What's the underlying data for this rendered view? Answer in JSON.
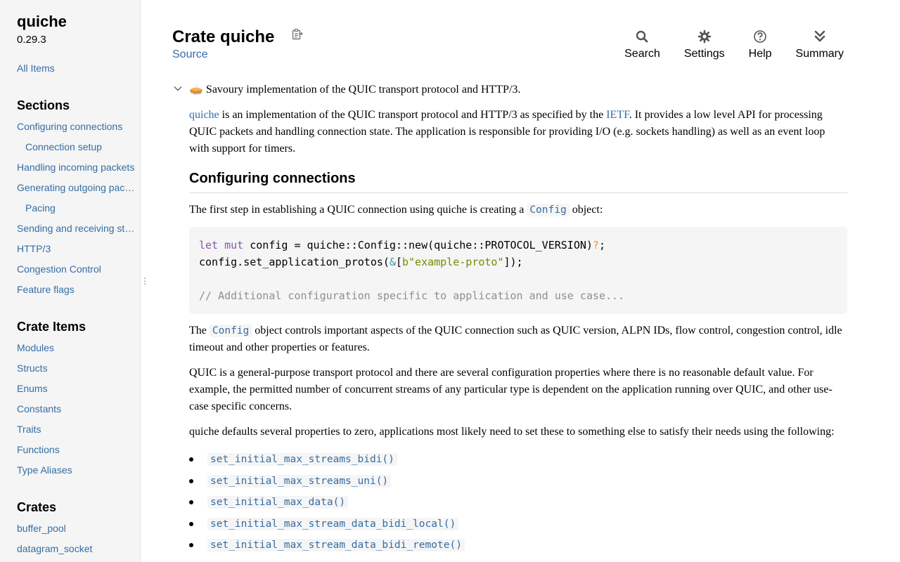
{
  "sidebar": {
    "crate_name": "quiche",
    "version": "0.29.3",
    "all_items": "All Items",
    "sections_heading": "Sections",
    "sections": [
      {
        "label": "Configuring connections",
        "sub": false
      },
      {
        "label": "Connection setup",
        "sub": true
      },
      {
        "label": "Handling incoming packets",
        "sub": false
      },
      {
        "label": "Generating outgoing packets",
        "sub": false
      },
      {
        "label": "Pacing",
        "sub": true
      },
      {
        "label": "Sending and receiving stream data",
        "sub": false
      },
      {
        "label": "HTTP/3",
        "sub": false
      },
      {
        "label": "Congestion Control",
        "sub": false
      },
      {
        "label": "Feature flags",
        "sub": false
      }
    ],
    "crate_items_heading": "Crate Items",
    "crate_items": [
      "Modules",
      "Structs",
      "Enums",
      "Constants",
      "Traits",
      "Functions",
      "Type Aliases"
    ],
    "crates_heading": "Crates",
    "crates": [
      "buffer_pool",
      "datagram_socket"
    ]
  },
  "header": {
    "title": "Crate quiche",
    "source": "Source"
  },
  "toolbar": {
    "search": "Search",
    "settings": "Settings",
    "help": "Help",
    "summary": "Summary"
  },
  "doc": {
    "summary": "🥧 Savoury implementation of the QUIC transport protocol and HTTP/3.",
    "intro_link": "quiche",
    "intro_1": " is an implementation of the QUIC transport protocol and HTTP/3 as specified by the ",
    "ietf_link": "IETF",
    "intro_2": ". It provides a low level API for processing QUIC packets and handling connection state. The application is responsible for providing I/O (e.g. sockets handling) as well as an event loop with support for timers.",
    "section_heading": "Configuring connections",
    "first_step_1": "The first step in establishing a QUIC connection using quiche is creating a ",
    "config": "Config",
    "first_step_2": " object:",
    "code": {
      "l1_kw1": "let",
      "l1_kw2": "mut",
      "l1_rest": " config = quiche::Config::new(quiche::PROTOCOL_VERSION)",
      "l1_q": "?",
      "l1_end": ";",
      "l2_a": "config.set_application_protos(",
      "l2_amp": "&",
      "l2_b": "[",
      "l2_str": "b\"example-proto\"",
      "l2_c": "]);",
      "comment": "// Additional configuration specific to application and use case..."
    },
    "config_para_1": "The ",
    "config_para_2": " object controls important aspects of the QUIC connection such as QUIC version, ALPN IDs, flow control, congestion control, idle timeout and other properties or features.",
    "quic_para": "QUIC is a general-purpose transport protocol and there are several configuration properties where there is no reasonable default value. For example, the permitted number of concurrent streams of any particular type is dependent on the application running over QUIC, and other use-case specific concerns.",
    "defaults_para": "quiche defaults several properties to zero, applications most likely need to set these to something else to satisfy their needs using the following:",
    "functions": [
      "set_initial_max_streams_bidi()",
      "set_initial_max_streams_uni()",
      "set_initial_max_data()",
      "set_initial_max_stream_data_bidi_local()",
      "set_initial_max_stream_data_bidi_remote()"
    ]
  },
  "colors": {
    "link": "#356da4",
    "sidebar_bg": "#f5f5f5",
    "code_bg": "#f5f5f5"
  }
}
